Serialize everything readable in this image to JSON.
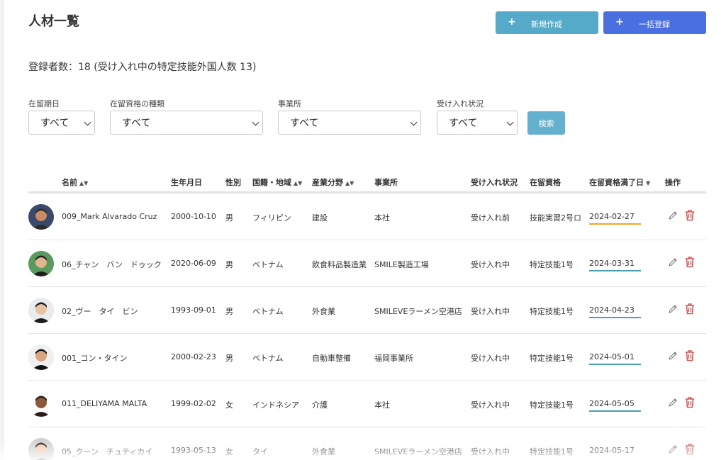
{
  "page": {
    "title": "人材一覧"
  },
  "actions": {
    "new_label": "新規作成",
    "bulk_label": "一括登録",
    "plus": "+"
  },
  "summary": "登録者数：18 (受け入れ中の特定技能外国人数 13)",
  "filters": [
    {
      "label": "在留期日",
      "value": "すべて"
    },
    {
      "label": "在留資格の種類",
      "value": "すべて"
    },
    {
      "label": "事業所",
      "value": "すべて"
    },
    {
      "label": "受け入れ状況",
      "value": "すべて"
    }
  ],
  "search_label": "検索",
  "table": {
    "headers": [
      "名前",
      "生年月日",
      "性別",
      "国籍・地域",
      "産業分野",
      "事業所",
      "受け入れ状況",
      "在留資格",
      "在留資格満了日",
      "操作"
    ],
    "rows": [
      {
        "name": "009_Mark Alvarado Cruz",
        "birth": "2000-10-10",
        "sex": "男",
        "country": "フィリピン",
        "industry": "建設",
        "office": "本社",
        "status": "受け入れ前",
        "visa": "技能実習2号ロ",
        "expiry": "2024-02-27"
      },
      {
        "name": "06_チャン　バン　ドゥック",
        "birth": "2020-06-09",
        "sex": "男",
        "country": "ベトナム",
        "industry": "飲食料品製造業",
        "office": "SMILE製造工場",
        "status": "受け入れ中",
        "visa": "特定技能1号",
        "expiry": "2024-03-31"
      },
      {
        "name": "02_ヴー　タイ　ビン",
        "birth": "1993-09-01",
        "sex": "男",
        "country": "ベトナム",
        "industry": "外食業",
        "office": "SMILEVEラーメン空港店",
        "status": "受け入れ中",
        "visa": "特定技能1号",
        "expiry": "2024-04-23"
      },
      {
        "name": "001_コン・タイン",
        "birth": "2000-02-23",
        "sex": "男",
        "country": "ベトナム",
        "industry": "自動車整備",
        "office": "福岡事業所",
        "status": "受け入れ中",
        "visa": "特定技能1号",
        "expiry": "2024-05-01"
      },
      {
        "name": "011_DELIYAMA MALTA",
        "birth": "1999-02-02",
        "sex": "女",
        "country": "インドネシア",
        "industry": "介護",
        "office": "本社",
        "status": "受け入れ中",
        "visa": "特定技能1号",
        "expiry": "2024-05-05"
      },
      {
        "name": "05_クーン　チュティカイ",
        "birth": "1993-05-13",
        "sex": "女",
        "country": "タイ",
        "industry": "外食業",
        "office": "SMILEVEラーメン空港店",
        "status": "受け入れ中",
        "visa": "特定技能1号",
        "expiry": "2024-05-17"
      }
    ]
  },
  "colors": {
    "new_button": "#55a9c9",
    "bulk_button": "#4a6fe0",
    "search_button": "#63b1cf",
    "expiry_ok": "#4b9fb3",
    "expiry_warn": "#f5a623",
    "delete": "#d9534f"
  }
}
